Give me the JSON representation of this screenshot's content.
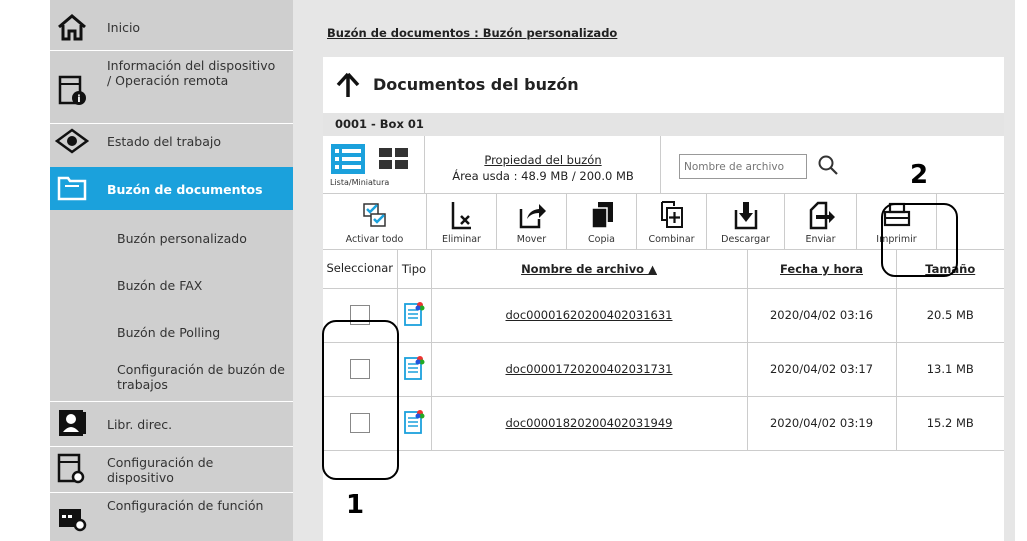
{
  "sidebar": {
    "items": [
      {
        "label": "Inicio",
        "icon": "home-icon"
      },
      {
        "label": "Información del dispositivo / Operación remota",
        "icon": "device-info-icon"
      },
      {
        "label": "Estado del trabajo",
        "icon": "eye-icon"
      },
      {
        "label": "Buzón de documentos",
        "icon": "folder-icon",
        "active": true
      },
      {
        "label": "Libr. direc.",
        "icon": "address-book-icon"
      },
      {
        "label": "Configuración de dispositivo",
        "icon": "device-settings-icon"
      },
      {
        "label": "Configuración de función",
        "icon": "function-settings-icon"
      }
    ],
    "subitems": [
      "Buzón personalizado",
      "Buzón de FAX",
      "Buzón de Polling",
      "Configuración de buzón de trabajos"
    ],
    "active_color": "#1ba1dc"
  },
  "breadcrumb": "Buzón de documentos : Buzón personalizado",
  "panel": {
    "title": "Documentos del buzón",
    "box_name": "0001 - Box 01",
    "view_toggle_label": "Lista/Miniatura",
    "property_link": "Propiedad del buzón",
    "usage": "Área usda : 48.9 MB / 200.0 MB",
    "search_placeholder": "Nombre de archivo"
  },
  "toolbar": {
    "activate_all": "Activar todo",
    "delete": "Eliminar",
    "move": "Mover",
    "copy": "Copia",
    "combine": "Combinar",
    "download": "Descargar",
    "send": "Enviar",
    "print": "Imprimir"
  },
  "table": {
    "headers": {
      "select": "Seleccionar",
      "type": "Tipo",
      "filename": "Nombre de archivo ▲",
      "datetime": "Fecha y hora",
      "size": "Tamaño"
    },
    "rows": [
      {
        "filename": "doc00001620200402031631",
        "datetime": "2020/04/02 03:16",
        "size": "20.5 MB"
      },
      {
        "filename": "doc00001720200402031731",
        "datetime": "2020/04/02 03:17",
        "size": "13.1 MB"
      },
      {
        "filename": "doc00001820200402031949",
        "datetime": "2020/04/02 03:19",
        "size": "15.2 MB"
      }
    ]
  },
  "annotations": {
    "one": "1",
    "two": "2"
  }
}
